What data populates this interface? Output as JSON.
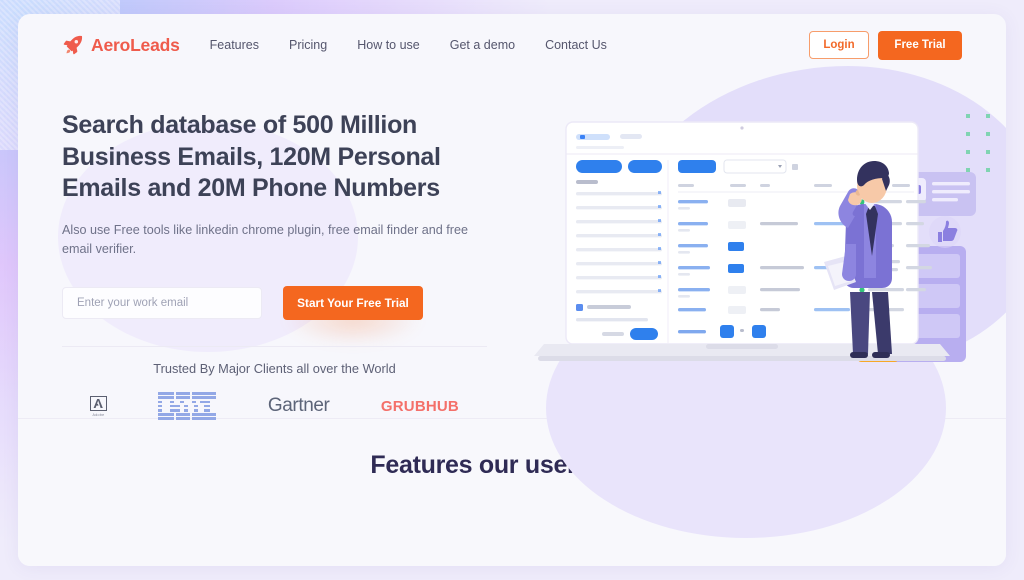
{
  "header": {
    "logo_text": "AeroLeads",
    "logo_icon": "rocket-icon",
    "nav": [
      {
        "label": "Features"
      },
      {
        "label": "Pricing"
      },
      {
        "label": "How to use"
      },
      {
        "label": "Get a demo"
      },
      {
        "label": "Contact Us"
      }
    ],
    "login_label": "Login",
    "free_trial_label": "Free Trial"
  },
  "hero": {
    "title": "Search database of 500 Million Business Emails, 120M Personal Emails and 20M Phone Numbers",
    "subtitle": "Also use Free tools like linkedin chrome plugin, free email finder and free email verifier.",
    "email_placeholder": "Enter your work email",
    "email_value": "",
    "cta_label": "Start Your Free Trial"
  },
  "trusted": {
    "title": "Trusted By Major Clients all over the World",
    "logos": [
      {
        "name": "Adobe",
        "word": "Adobe",
        "color": "#5b5f70"
      },
      {
        "name": "IBM",
        "color": "#93a8e6"
      },
      {
        "name": "Gartner",
        "color": "#5c6478"
      },
      {
        "name": "GRUBHUB",
        "color": "#f4706a"
      }
    ]
  },
  "features": {
    "title": "Features our users love!"
  },
  "colors": {
    "brand_orange": "#f4671f",
    "logo_red": "#ef5b4c",
    "headline": "#3d4257",
    "features_heading": "#2f2b55",
    "page_bg": "#f7f7fc",
    "outer_bg": "#efecfb",
    "blob_lavender": "#e3defa"
  }
}
